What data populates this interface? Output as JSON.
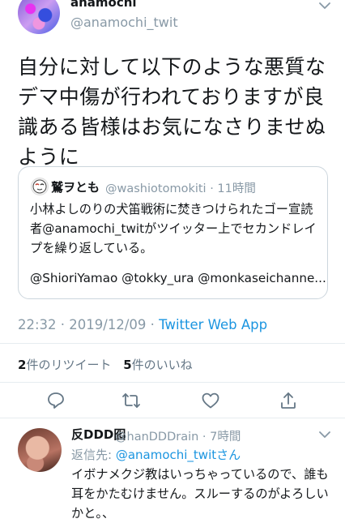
{
  "colors": {
    "link": "#1b95e0",
    "muted": "#8899a6",
    "text": "#14171a",
    "divider": "#e6ecf0"
  },
  "tweet": {
    "display_name": "anamochi",
    "handle": "@anamochi_twit",
    "text": "自分に対して以下のような悪質なデマ中傷が行われておりますが良識ある皆様はお気になさりませぬように",
    "timestamp": "22:32 · 2019/12/09 · ",
    "source_app": "Twitter Web App"
  },
  "quote": {
    "display_name": "鷲ヲとも",
    "handle_time": "@washiotomokiti · 11時間",
    "text": "小林よしのりの犬笛戦術に焚きつけられたゴー宣読者@anamochi_twitがツイッター上でセカンドレイプを繰り返している。",
    "mentions": "@ShioriYamao @tokky_ura @monkaseichanne..."
  },
  "stats": {
    "retweet_count": "2",
    "retweet_label": "件のリツイート",
    "like_count": "5",
    "like_label": "件のいいね"
  },
  "actions": [
    "reply-icon",
    "retweet-icon",
    "like-icon",
    "share-icon"
  ],
  "reply": {
    "display_name": "反DDD囮",
    "handle_time": "@hanDDDrain · 7時間",
    "replying_prefix": "返信先: ",
    "replying_to": "@anamochi_twit",
    "replying_suffix": "さん",
    "text": "イボナメクジ教はいっちゃっているので、誰も耳をかたむけません。スルーするのがよろしいかと。、"
  }
}
